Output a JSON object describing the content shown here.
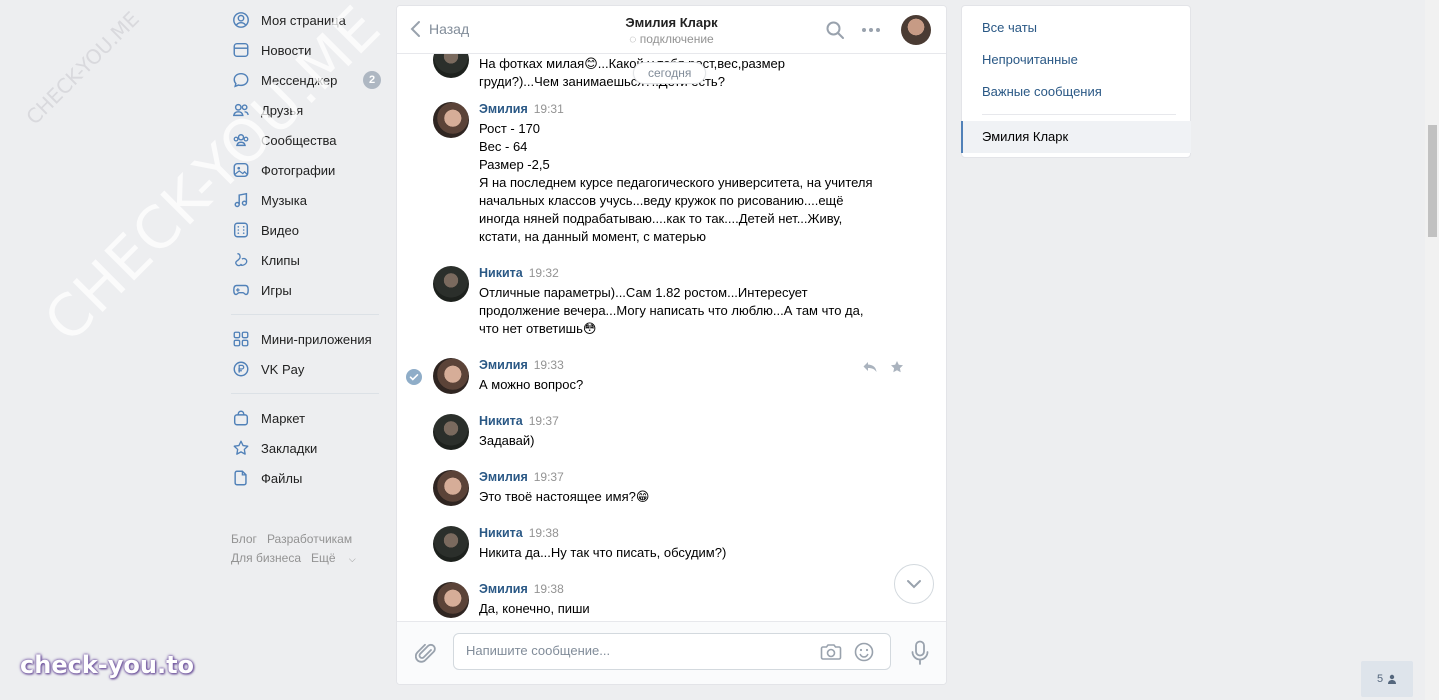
{
  "nav": {
    "items": [
      {
        "label": "Моя страница",
        "icon": "user-circle-icon"
      },
      {
        "label": "Новости",
        "icon": "newspaper-icon"
      },
      {
        "label": "Мессенджер",
        "icon": "message-icon",
        "badge": "2"
      },
      {
        "label": "Друзья",
        "icon": "friends-icon"
      },
      {
        "label": "Сообщества",
        "icon": "groups-icon"
      },
      {
        "label": "Фотографии",
        "icon": "photo-icon"
      },
      {
        "label": "Музыка",
        "icon": "music-icon"
      },
      {
        "label": "Видео",
        "icon": "video-icon"
      },
      {
        "label": "Клипы",
        "icon": "clips-icon"
      },
      {
        "label": "Игры",
        "icon": "gamepad-icon"
      },
      {
        "label": "Мини-приложения",
        "icon": "apps-icon"
      },
      {
        "label": "VK Pay",
        "icon": "vkpay-icon"
      },
      {
        "label": "Маркет",
        "icon": "market-bag-icon"
      },
      {
        "label": "Закладки",
        "icon": "star-icon"
      },
      {
        "label": "Файлы",
        "icon": "file-icon"
      }
    ],
    "footer": [
      "Блог",
      "Разработчикам",
      "Для бизнеса",
      "Ещё"
    ]
  },
  "chat": {
    "back_label": "Назад",
    "peer_name": "Эмилия Кларк",
    "peer_status": "подключение",
    "date_pill": "сегодня",
    "messages": [
      {
        "author": "",
        "time": "",
        "text": "На фотках милая😊...Какой у тебя рост,вес,размер\nгруди?)...Чем занимаешься?..Дети есть?"
      },
      {
        "author": "Эмилия",
        "time": "19:31",
        "text": "Рост - 170\nВес - 64\nРазмер -2,5\nЯ на последнем курсе педагогического университета, на учителя начальных классов учусь...веду кружок по рисованию....ещё иногда няней подрабатываю....как то так....Детей нет...Живу, кстати, на данный момент, с матерью"
      },
      {
        "author": "Никита",
        "time": "19:32",
        "text": "Отличные параметры)...Сам 1.82 ростом...Интересует продолжение вечера...Могу написать что люблю...А там что да, что нет ответишь😳"
      },
      {
        "author": "Эмилия",
        "time": "19:33",
        "text": "А можно вопрос?"
      },
      {
        "author": "Никита",
        "time": "19:37",
        "text": "Задавай)"
      },
      {
        "author": "Эмилия",
        "time": "19:37",
        "text": "Это твоё настоящее имя?😁"
      },
      {
        "author": "Никита",
        "time": "19:38",
        "text": "Никита да...Ну так что писать, обсудим?)"
      },
      {
        "author": "Эмилия",
        "time": "19:38",
        "text": "Да, конечно, пиши"
      }
    ],
    "composer_placeholder": "Напишите сообщение..."
  },
  "right_panel": {
    "links": [
      "Все чаты",
      "Непрочитанные",
      "Важные сообщения"
    ],
    "active_chat": "Эмилия Кларк"
  },
  "online_count": "5",
  "watermarks": {
    "diagonal": "CHECK-YOU.ME",
    "bottom": "check-you.to"
  },
  "colors": {
    "link": "#2a5885",
    "accent": "#5181b8",
    "background": "#edeef0"
  }
}
